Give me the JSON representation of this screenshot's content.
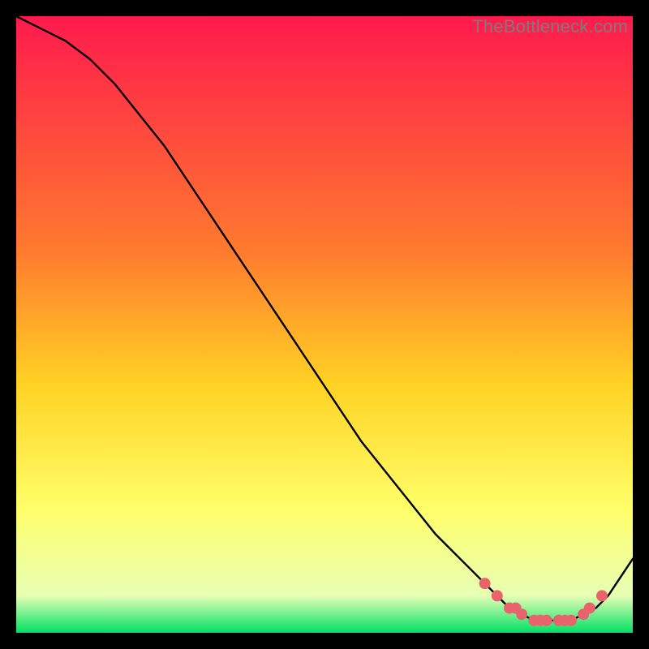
{
  "watermark": "TheBottleneck.com",
  "colors": {
    "gradient_top": "#ff1a4d",
    "gradient_mid1": "#ff7a2e",
    "gradient_mid2": "#ffd324",
    "gradient_mid3": "#ffff6a",
    "gradient_bottom1": "#e7ffb5",
    "gradient_bottom2": "#00e066",
    "curve": "#000000",
    "marker": "#e9636d",
    "frame_bg": "#000000"
  },
  "chart_data": {
    "type": "line",
    "title": "",
    "xlabel": "",
    "ylabel": "",
    "xlim": [
      0,
      100
    ],
    "ylim": [
      0,
      100
    ],
    "grid": false,
    "legend": false,
    "series": [
      {
        "name": "bottleneck-curve",
        "x": [
          0,
          4,
          8,
          12,
          16,
          20,
          24,
          28,
          32,
          36,
          40,
          44,
          48,
          52,
          56,
          60,
          64,
          68,
          72,
          76,
          78,
          80,
          82,
          84,
          86,
          88,
          90,
          92,
          94,
          96,
          98,
          100
        ],
        "y": [
          100,
          98,
          96,
          93,
          89,
          84,
          79,
          73,
          67,
          61,
          55,
          49,
          43,
          37,
          31,
          26,
          21,
          16,
          12,
          8,
          6,
          4,
          3,
          2,
          2,
          2,
          2,
          3,
          4,
          6,
          9,
          12
        ]
      }
    ],
    "markers": {
      "name": "highlight-dots",
      "x": [
        76,
        78,
        80,
        81,
        82,
        84,
        85,
        86,
        88,
        89,
        90,
        92,
        93,
        95
      ],
      "y": [
        8,
        6,
        4,
        4,
        3,
        2,
        2,
        2,
        2,
        2,
        2,
        3,
        4,
        6
      ]
    }
  }
}
